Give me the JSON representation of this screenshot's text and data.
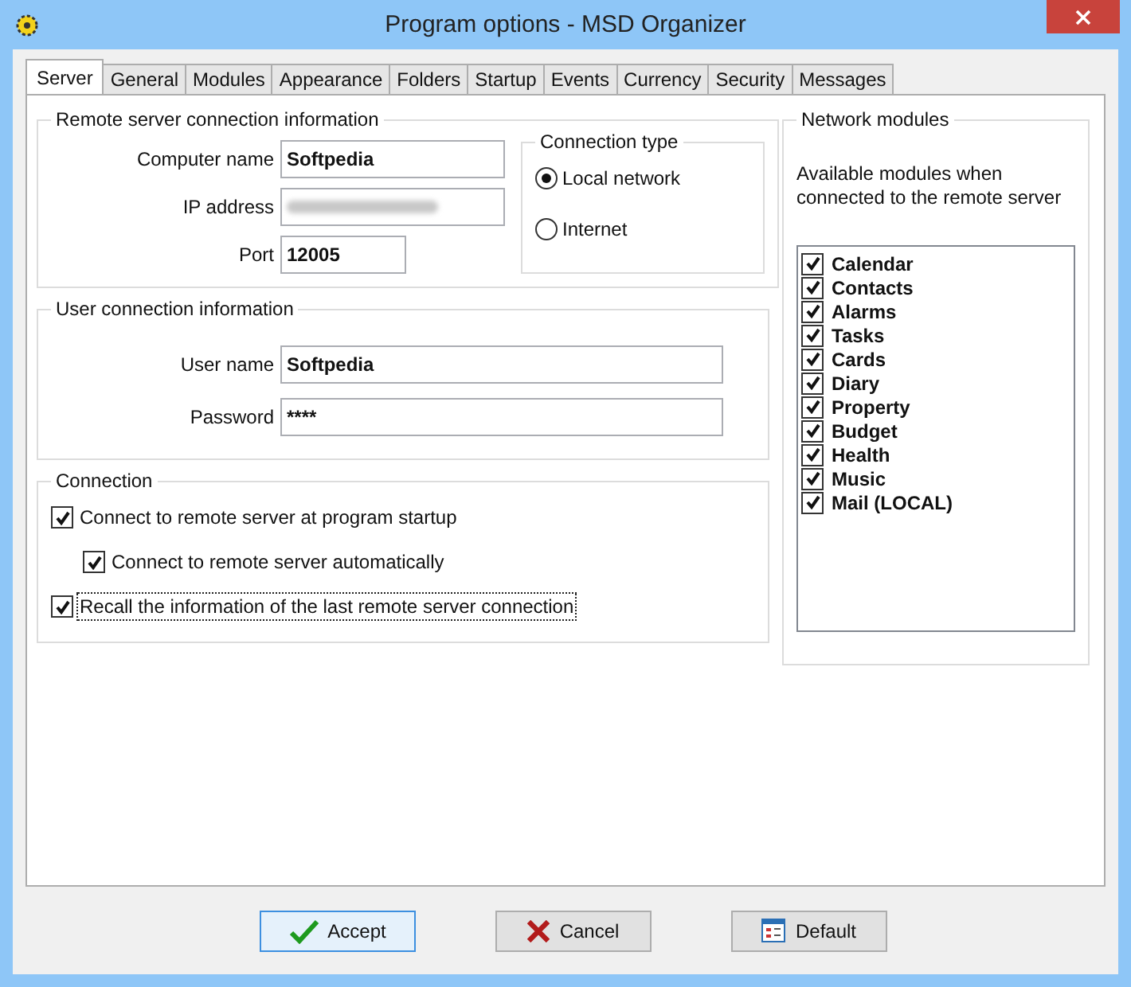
{
  "window": {
    "title": "Program options - MSD Organizer"
  },
  "tabs": [
    {
      "label": "Server",
      "selected": true
    },
    {
      "label": "General",
      "selected": false
    },
    {
      "label": "Modules",
      "selected": false
    },
    {
      "label": "Appearance",
      "selected": false
    },
    {
      "label": "Folders",
      "selected": false
    },
    {
      "label": "Startup",
      "selected": false
    },
    {
      "label": "Events",
      "selected": false
    },
    {
      "label": "Currency",
      "selected": false
    },
    {
      "label": "Security",
      "selected": false
    },
    {
      "label": "Messages",
      "selected": false
    }
  ],
  "remote_server": {
    "title": "Remote server connection information",
    "fields": [
      {
        "label": "Computer name",
        "value": "Softpedia",
        "kind": "wide"
      },
      {
        "label": "IP address",
        "kind": "blurred"
      },
      {
        "label": "Port",
        "value": "12005",
        "kind": "short"
      }
    ],
    "connection_type": {
      "title": "Connection type",
      "options": [
        {
          "label": "Local network",
          "selected": true
        },
        {
          "label": "Internet",
          "selected": false
        }
      ]
    }
  },
  "user_connection": {
    "title": "User connection information",
    "fields": [
      {
        "label": "User name",
        "value": "Softpedia"
      },
      {
        "label": "Password",
        "value": "****"
      }
    ]
  },
  "connection": {
    "title": "Connection",
    "options": [
      {
        "label": "Connect to remote server at program startup",
        "checked": true,
        "focused": false,
        "children": [
          {
            "label": "Connect to remote server automatically",
            "checked": true,
            "focused": false
          }
        ]
      },
      {
        "label": "Recall the information of the last remote server connection",
        "checked": true,
        "focused": true
      }
    ]
  },
  "network_modules": {
    "title": "Network modules",
    "description": "Available modules when connected to the remote server",
    "modules": [
      {
        "label": "Calendar",
        "checked": true
      },
      {
        "label": "Contacts",
        "checked": true
      },
      {
        "label": "Alarms",
        "checked": true
      },
      {
        "label": "Tasks",
        "checked": true
      },
      {
        "label": "Cards",
        "checked": true
      },
      {
        "label": "Diary",
        "checked": true
      },
      {
        "label": "Property",
        "checked": true
      },
      {
        "label": "Budget",
        "checked": true
      },
      {
        "label": "Health",
        "checked": true
      },
      {
        "label": "Music",
        "checked": true
      },
      {
        "label": "Mail  (LOCAL)",
        "checked": true
      }
    ]
  },
  "buttons": [
    {
      "label": "Accept",
      "kind": "accept",
      "default": true
    },
    {
      "label": "Cancel",
      "kind": "cancel",
      "default": false
    },
    {
      "label": "Default",
      "kind": "default",
      "default": false
    }
  ]
}
